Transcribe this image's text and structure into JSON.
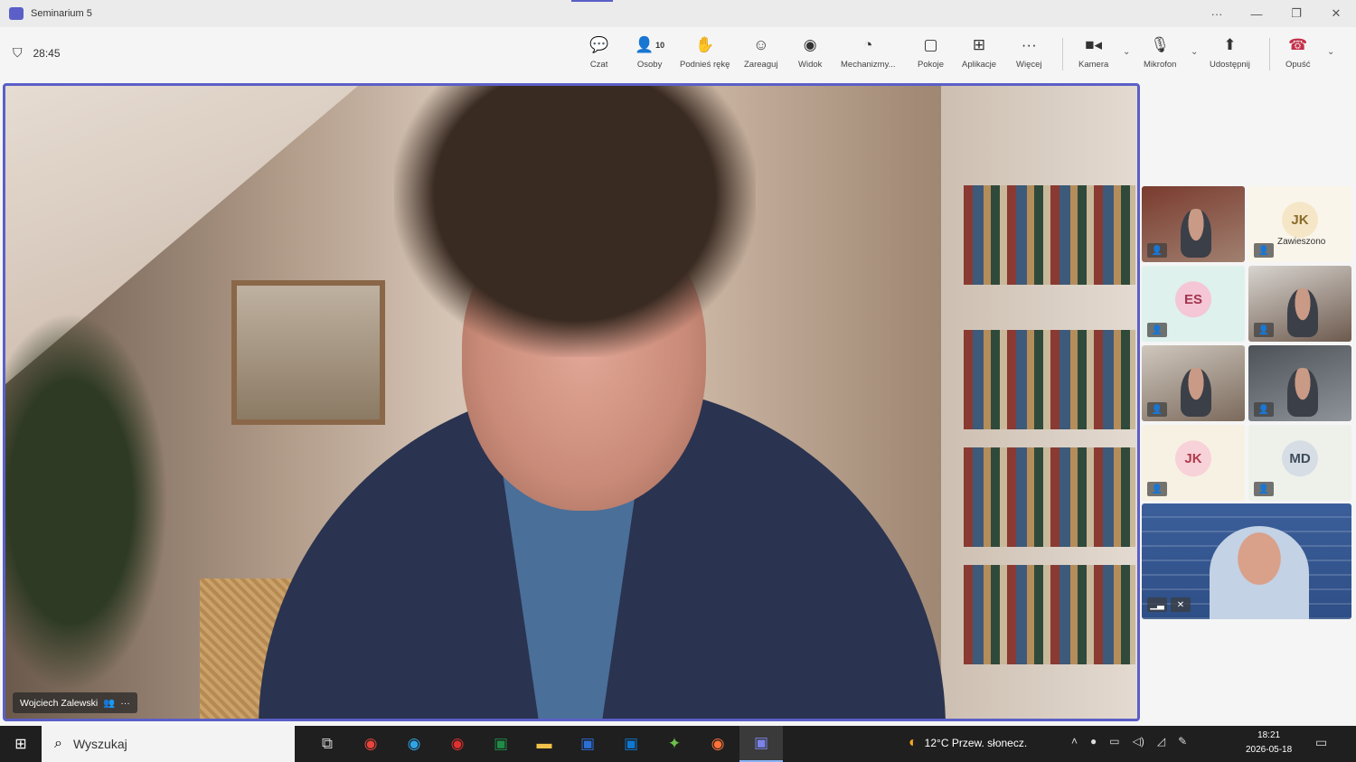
{
  "window": {
    "title": "Seminarium 5",
    "controls": [
      "···",
      "—",
      "❐",
      "✕"
    ]
  },
  "meeting": {
    "timer": "28:45"
  },
  "toolbar": {
    "chat": "Czat",
    "people": "Osoby",
    "people_count": "10",
    "raise_hand": "Podnieś rękę",
    "react": "Zareaguj",
    "view": "Widok",
    "tools": "Mechanizmy...",
    "rooms": "Pokoje",
    "apps": "Aplikacje",
    "more": "Więcej",
    "camera": "Kamera",
    "mic": "Mikrofon",
    "share": "Udostępnij",
    "leave": "Opuść"
  },
  "main_video": {
    "name": "Wojciech Zalewski",
    "more": "···"
  },
  "participants": [
    {
      "type": "video",
      "colors": [
        "#7a3b2e",
        "#a08070"
      ]
    },
    {
      "type": "avatar",
      "initials": "JK",
      "avatar_bg": "#f5e6c8",
      "avatar_fg": "#8a6b2a",
      "tile_bg": "#faf5ea",
      "status": "Zawieszono"
    },
    {
      "type": "avatar",
      "initials": "ES",
      "avatar_bg": "#f4c6d6",
      "avatar_fg": "#a3344e",
      "tile_bg": "#dff1ec"
    },
    {
      "type": "video",
      "colors": [
        "#d8d4cf",
        "#6d5a4e"
      ]
    },
    {
      "type": "video",
      "colors": [
        "#cfc7bd",
        "#7b6a5c"
      ]
    },
    {
      "type": "video",
      "colors": [
        "#4c5258",
        "#8f939a"
      ]
    },
    {
      "type": "avatar",
      "initials": "JK",
      "avatar_bg": "#f7d2d8",
      "avatar_fg": "#b03a4f",
      "tile_bg": "#f7f1e3"
    },
    {
      "type": "avatar",
      "initials": "MD",
      "avatar_bg": "#d6dde4",
      "avatar_fg": "#3e4c5a",
      "tile_bg": "#eef1ea"
    }
  ],
  "taskbar": {
    "search_placeholder": "Wyszukaj",
    "weather": "12°C  Przew. słonecz.",
    "time": "18:21",
    "date": "2026-05-18"
  }
}
